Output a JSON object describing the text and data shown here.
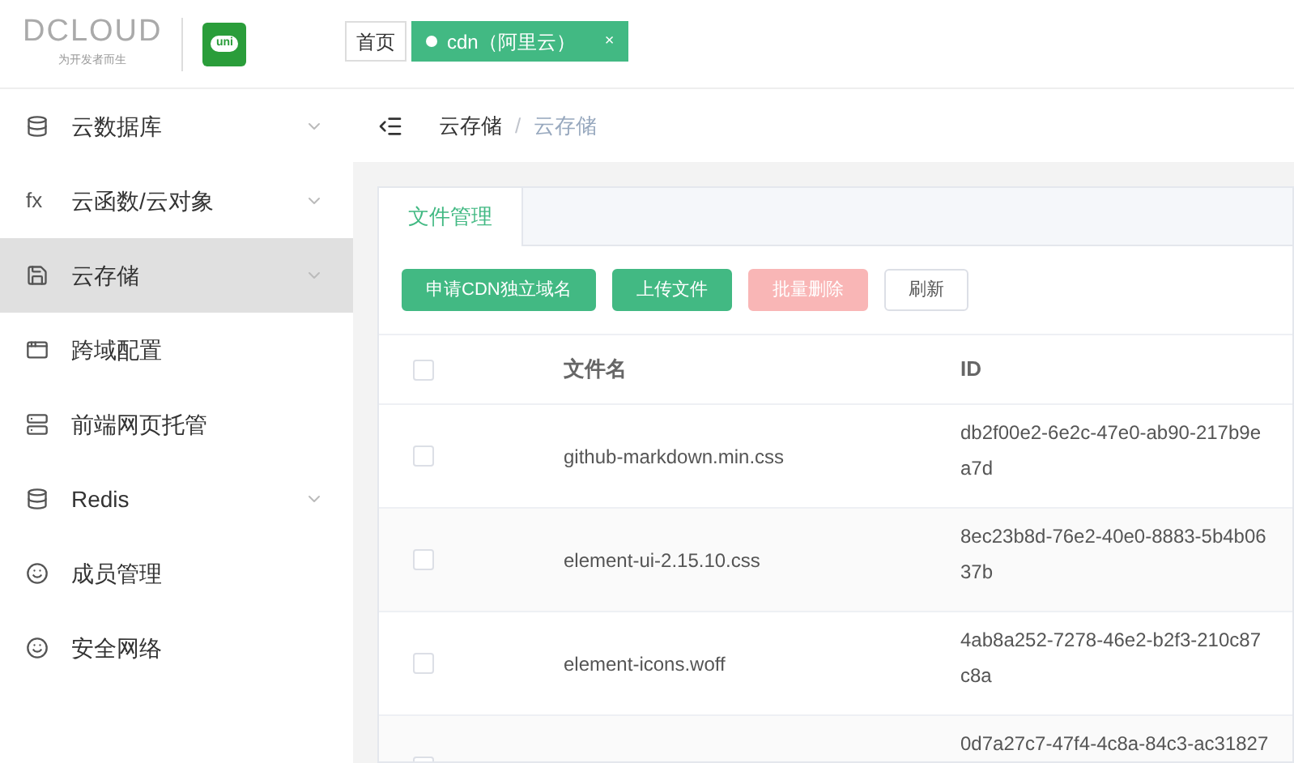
{
  "logo": {
    "wordmark": "DCLOUD",
    "tagline": "为开发者而生",
    "app_badge": "uni"
  },
  "page_tabs": [
    {
      "label": "首页",
      "selected": false,
      "closable": false
    },
    {
      "label": "cdn（阿里云）",
      "selected": true,
      "closable": true,
      "close": "×"
    }
  ],
  "sidebar": {
    "items": [
      {
        "label": "云数据库",
        "kind": "database",
        "expandable": true,
        "selected": false
      },
      {
        "label": "云函数/云对象",
        "kind": "function",
        "icon_text": "fx",
        "expandable": true,
        "selected": false
      },
      {
        "label": "云存储",
        "kind": "storage",
        "expandable": true,
        "selected": true
      },
      {
        "label": "跨域配置",
        "kind": "window",
        "expandable": false,
        "selected": false
      },
      {
        "label": "前端网页托管",
        "kind": "server",
        "expandable": false,
        "selected": false
      },
      {
        "label": "Redis",
        "kind": "database",
        "expandable": true,
        "selected": false
      },
      {
        "label": "成员管理",
        "kind": "face",
        "expandable": false,
        "selected": false
      },
      {
        "label": "安全网络",
        "kind": "face",
        "expandable": false,
        "selected": false
      }
    ]
  },
  "breadcrumb": [
    "云存储",
    "云存储"
  ],
  "breadcrumb_separator": "/",
  "card_tabs": [
    {
      "label": "文件管理",
      "selected": true
    }
  ],
  "buttons": [
    {
      "label": "申请CDN独立域名",
      "kind": "primary",
      "disabled": false
    },
    {
      "label": "上传文件",
      "kind": "primary",
      "disabled": false
    },
    {
      "label": "批量删除",
      "kind": "danger",
      "disabled": true
    },
    {
      "label": "刷新",
      "kind": "plain",
      "disabled": false
    }
  ],
  "table": {
    "columns": [
      "文件名",
      "ID"
    ],
    "header_checked": false,
    "rows": [
      {
        "name": "github-markdown.min.css",
        "id_lines": [
          "db2f00e2-6e2c-47e0-ab90-217b9e",
          "a7d"
        ],
        "checked": false
      },
      {
        "name": "element-ui-2.15.10.css",
        "id_lines": [
          "8ec23b8d-76e2-40e0-8883-5b4b06",
          "37b"
        ],
        "checked": false
      },
      {
        "name": "element-icons.woff",
        "id_lines": [
          "4ab8a252-7278-46e2-b2f3-210c87",
          "c8a"
        ],
        "checked": false
      },
      {
        "id_lines": [
          "0d7a27c7-47f4-4c8a-84c3-ac31827"
        ],
        "checked": false
      }
    ]
  }
}
